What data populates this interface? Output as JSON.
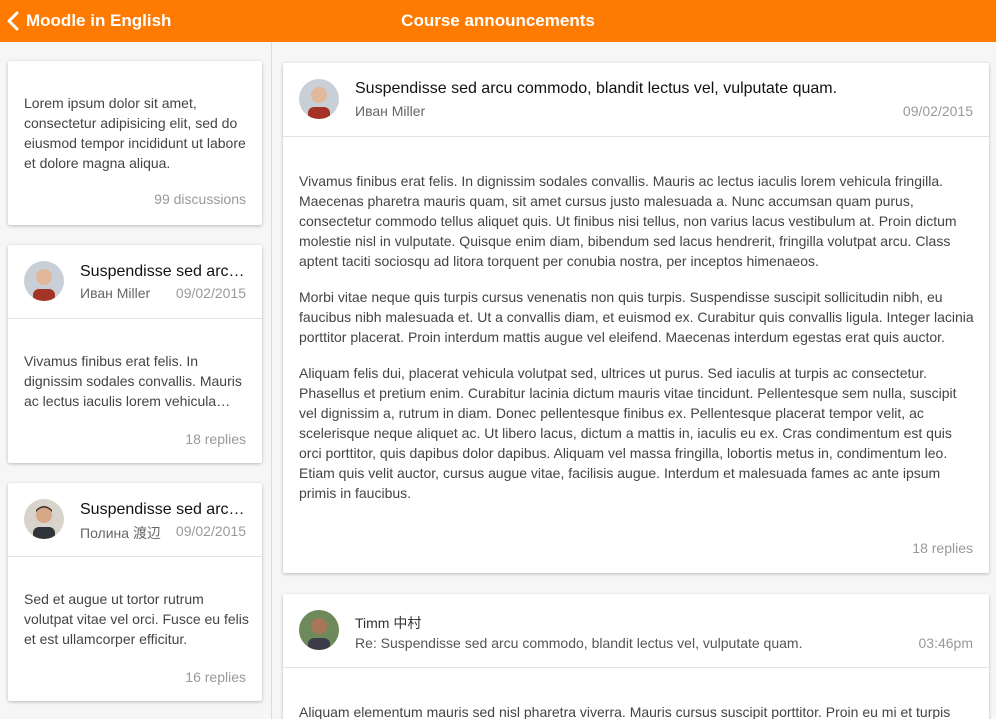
{
  "header": {
    "back_label": "Moodle in English",
    "title": "Course announcements",
    "accent_color": "#ff7a00"
  },
  "forum_summary": {
    "intro": "Lorem ipsum dolor sit amet, consectetur adipisicing elit, sed do eiusmod tempor incididunt ut labore et dolore magna aliqua.",
    "count": "99 discussions"
  },
  "discussions": [
    {
      "title": "Suspendisse sed arcu commodo, blandit lectus vel, vulputate quam.",
      "author": "Иван Miller",
      "date": "09/02/2015",
      "excerpt": "Vivamus finibus erat felis. In dignissim sodales convallis. Mauris ac lectus iaculis lorem vehicula fringilla.",
      "replies": "18 replies"
    },
    {
      "title": "Suspendisse sed arcu commodo, blandit lectus vel, vulputate quam.",
      "author": "Полина 渡辺",
      "date": "09/02/2015",
      "excerpt": "Sed et augue ut tortor rutrum volutpat vitae vel orci. Fusce eu felis et est ullamcorper efficitur.",
      "replies": "16 replies"
    }
  ],
  "main_post": {
    "title": "Suspendisse sed arcu commodo, blandit lectus vel, vulputate quam.",
    "author": "Иван Miller",
    "date": "09/02/2015",
    "paragraphs": [
      "Vivamus finibus erat felis. In dignissim sodales convallis. Mauris ac lectus iaculis lorem vehicula fringilla. Maecenas pharetra mauris quam, sit amet cursus justo malesuada a. Nunc accumsan quam purus, consectetur commodo tellus aliquet quis. Ut finibus nisi tellus, non varius lacus vestibulum at. Proin dictum molestie nisl in vulputate. Quisque enim diam, bibendum sed lacus hendrerit, fringilla volutpat arcu. Class aptent taciti sociosqu ad litora torquent per conubia nostra, per inceptos himenaeos.",
      "Morbi vitae neque quis turpis cursus venenatis non quis turpis. Suspendisse suscipit sollicitudin nibh, eu faucibus nibh malesuada et. Ut a convallis diam, et euismod ex. Curabitur quis convallis ligula. Integer lacinia porttitor placerat. Proin interdum mattis augue vel eleifend. Maecenas interdum egestas erat quis auctor.",
      "Aliquam felis dui, placerat vehicula volutpat sed, ultrices ut purus. Sed iaculis at turpis ac consectetur. Phasellus et pretium enim. Curabitur lacinia dictum mauris vitae tincidunt. Pellentesque sem nulla, suscipit vel dignissim a, rutrum in diam. Donec pellentesque finibus ex. Pellentesque placerat tempor velit, ac scelerisque neque aliquet ac. Ut libero lacus, dictum a mattis in, iaculis eu ex. Cras condimentum est quis orci porttitor, quis dapibus dolor dapibus. Aliquam vel massa fringilla, lobortis metus in, condimentum leo. Etiam quis velit auctor, cursus augue vitae, facilisis augue. Interdum et malesuada fames ac ante ipsum primis in faucibus."
    ],
    "replies": "18 replies"
  },
  "reply_post": {
    "author": "Timm 中村",
    "subject": "Re: Suspendisse sed arcu commodo, blandit lectus vel, vulputate quam.",
    "time": "03:46pm",
    "body": "Aliquam elementum mauris sed nisl pharetra viverra. Mauris cursus suscipit porttitor. Proin eu mi et turpis"
  },
  "icons": {
    "back": "chevron-left-icon",
    "avatar": "user-avatar"
  }
}
